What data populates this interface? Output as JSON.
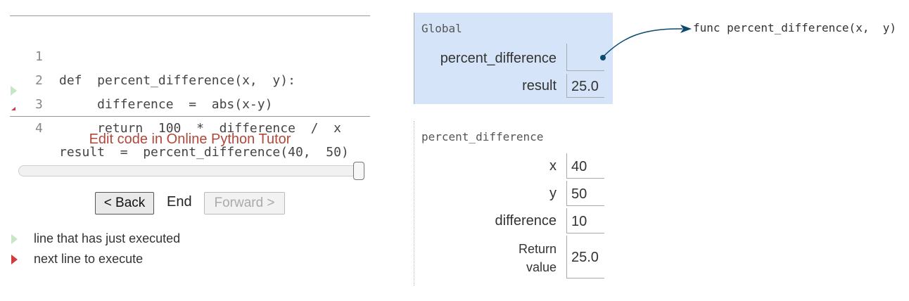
{
  "code": {
    "lines": [
      {
        "num": "1",
        "text": "def  percent_difference(x,  y):"
      },
      {
        "num": "2",
        "text": "     difference  =  abs(x-y)"
      },
      {
        "num": "3",
        "text": "     return  100  *  difference  /  x"
      },
      {
        "num": "4",
        "text": "result  =  percent_difference(40,  50)"
      }
    ]
  },
  "controls": {
    "edit_link": "Edit code in Online Python Tutor",
    "back_label": "< Back",
    "end_label": "End",
    "forward_label": "Forward >",
    "slider_position": 1.0
  },
  "legend": {
    "executed": "line that has just executed",
    "next": "next line to execute"
  },
  "global_frame": {
    "title": "Global",
    "vars": [
      {
        "name": "percent_difference",
        "value": ""
      },
      {
        "name": "result",
        "value": "25.0"
      }
    ]
  },
  "func_frame": {
    "title": "percent_difference",
    "vars": [
      {
        "name": "x",
        "value": "40"
      },
      {
        "name": "y",
        "value": "50"
      },
      {
        "name": "difference",
        "value": "10"
      }
    ],
    "return_label_1": "Return",
    "return_label_2": "value",
    "return_value": "25.0"
  },
  "heap": {
    "func_object": "func percent_difference(x,  y)"
  },
  "colors": {
    "global_frame_bg": "#d5e4f8",
    "pointer": "#0b4a6e",
    "link": "#b0483a",
    "executed_arrow": "#c7e6c5",
    "next_arrow": "#d03b3b"
  }
}
